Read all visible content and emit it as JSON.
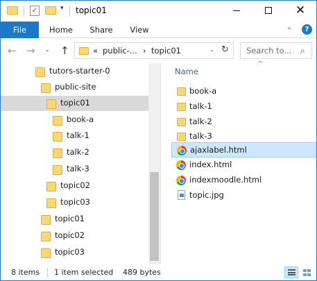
{
  "window": {
    "title": "topic01",
    "minimize_icon": "minimize-icon",
    "maximize_icon": "maximize-icon",
    "close_glyph": "✕"
  },
  "quick_access": {
    "dropdown_glyph": "▾",
    "check_glyph": "✓"
  },
  "ribbon": {
    "tabs": [
      "File",
      "Home",
      "Share",
      "View"
    ],
    "expand_glyph": "⌄",
    "help_glyph": "?"
  },
  "nav": {
    "back_glyph": "←",
    "forward_glyph": "→",
    "recent_glyph": "⌄",
    "up_glyph": "↑",
    "address": {
      "overflow": "«",
      "segment1": "public-...",
      "separator": "›",
      "segment2": "topic01",
      "dropdown_glyph": "⌄",
      "refresh_glyph": "↻"
    },
    "search": {
      "placeholder": "Search to...",
      "icon_glyph": "⌕"
    }
  },
  "tree": [
    {
      "label": "tutors-starter-0",
      "level": 0,
      "selected": false
    },
    {
      "label": "public-site",
      "level": 1,
      "selected": false
    },
    {
      "label": "topic01",
      "level": 2,
      "selected": true
    },
    {
      "label": "book-a",
      "level": 3,
      "selected": false
    },
    {
      "label": "talk-1",
      "level": 3,
      "selected": false
    },
    {
      "label": "talk-2",
      "level": 3,
      "selected": false
    },
    {
      "label": "talk-3",
      "level": 3,
      "selected": false
    },
    {
      "label": "topic02",
      "level": 2,
      "selected": false
    },
    {
      "label": "topic03",
      "level": 2,
      "selected": false
    },
    {
      "label": "topic01",
      "level": 1,
      "selected": false
    },
    {
      "label": "topic02",
      "level": 1,
      "selected": false
    },
    {
      "label": "topic03",
      "level": 1,
      "selected": false
    }
  ],
  "content": {
    "column_name": "Name",
    "sort_glyph": "^",
    "files": [
      {
        "name": "book-a",
        "type": "folder",
        "selected": false
      },
      {
        "name": "talk-1",
        "type": "folder",
        "selected": false
      },
      {
        "name": "talk-2",
        "type": "folder",
        "selected": false
      },
      {
        "name": "talk-3",
        "type": "folder",
        "selected": false
      },
      {
        "name": "ajaxlabel.html",
        "type": "chrome-html",
        "selected": true
      },
      {
        "name": "index.html",
        "type": "chrome-html",
        "selected": false
      },
      {
        "name": "indexmoodle.html",
        "type": "chrome-html",
        "selected": false
      },
      {
        "name": "topic.jpg",
        "type": "image",
        "selected": false
      }
    ]
  },
  "status": {
    "item_count": "8 items",
    "selection": "1 item selected",
    "size": "489 bytes"
  },
  "colors": {
    "accent": "#1979ca",
    "selection_bg": "#cce8ff",
    "selection_border": "#99d1ff",
    "tree_selected": "#d9d9d9",
    "folder": "#f8d775"
  }
}
